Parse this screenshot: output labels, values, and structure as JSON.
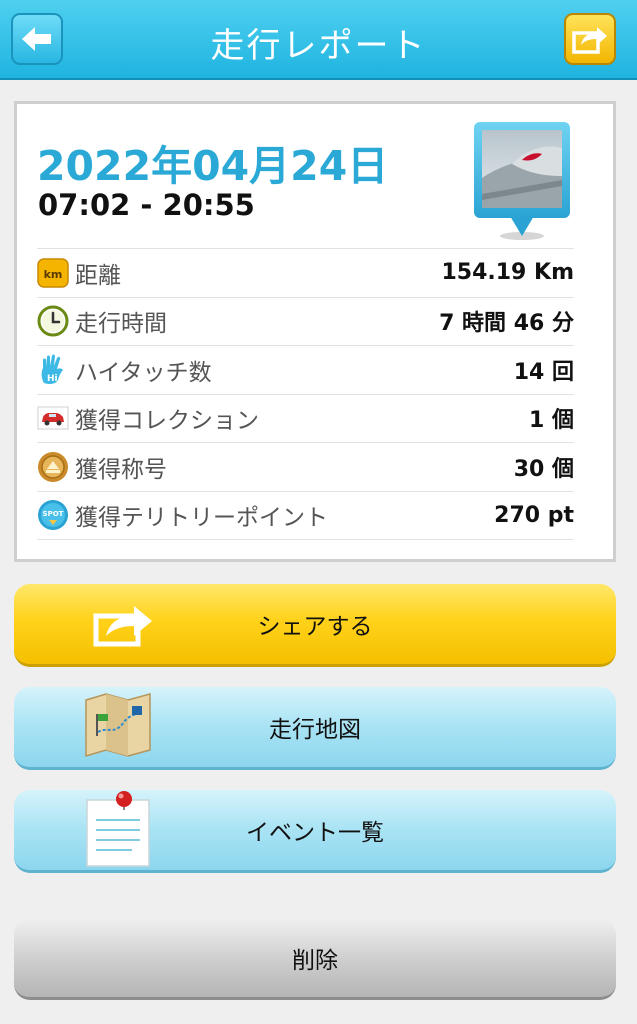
{
  "header": {
    "title": "走行レポート",
    "back_icon": "arrow-left-icon",
    "share_icon": "share-icon"
  },
  "report": {
    "date": "2022年04月24日",
    "time_range": "07:02 - 20:55",
    "rows": [
      {
        "icon": "km-icon",
        "label": "距離",
        "value": "154.19 Km"
      },
      {
        "icon": "clock-icon",
        "label": "走行時間",
        "value": "7 時間 46 分"
      },
      {
        "icon": "hi-hand-icon",
        "label": "ハイタッチ数",
        "value": "14 回"
      },
      {
        "icon": "car-icon",
        "label": "獲得コレクション",
        "value": "1 個"
      },
      {
        "icon": "medal-icon",
        "label": "獲得称号",
        "value": "30 個"
      },
      {
        "icon": "spot-icon",
        "label": "獲得テリトリーポイント",
        "value": "270 pt"
      }
    ]
  },
  "actions": {
    "share": "シェアする",
    "map": "走行地図",
    "events": "イベント一覧",
    "delete": "削除"
  },
  "colors": {
    "header": "#1fb4e0",
    "accent": "#2aa9d6",
    "share_button": "#ffd21a"
  }
}
